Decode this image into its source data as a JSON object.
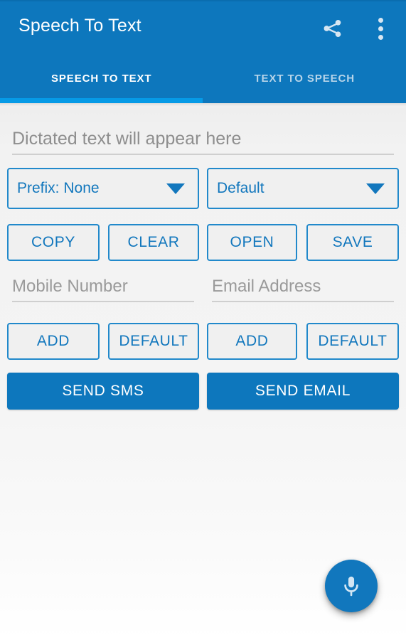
{
  "app": {
    "title": "Speech To Text",
    "accent_color": "#0d77bd",
    "indicator_color": "#069ae6",
    "outline_color": "#2189cb",
    "background_color": "#f4f4f4"
  },
  "appbar": {
    "title": "Speech To Text",
    "share_icon": "share-icon",
    "overflow_icon": "more-vert-icon"
  },
  "tabs": [
    {
      "label": "SPEECH TO TEXT",
      "active": true
    },
    {
      "label": "TEXT TO SPEECH",
      "active": false
    }
  ],
  "main": {
    "dictation": {
      "placeholder": "Dictated text will appear here",
      "value": ""
    },
    "spinners": [
      {
        "label": "Prefix: None",
        "icon": "chevron-down-icon"
      },
      {
        "label": "Default",
        "icon": "chevron-down-icon"
      }
    ],
    "action_buttons": [
      {
        "label": "COPY"
      },
      {
        "label": "CLEAR"
      },
      {
        "label": "OPEN"
      },
      {
        "label": "SAVE"
      }
    ],
    "contact_fields": [
      {
        "placeholder": "Mobile Number",
        "value": ""
      },
      {
        "placeholder": "Email Address",
        "value": ""
      }
    ],
    "contact_buttons": [
      {
        "label": "ADD"
      },
      {
        "label": "DEFAULT"
      },
      {
        "label": "ADD"
      },
      {
        "label": "DEFAULT"
      }
    ],
    "send_buttons": [
      {
        "label": "SEND SMS"
      },
      {
        "label": "SEND EMAIL"
      }
    ]
  },
  "fab": {
    "icon": "microphone-icon",
    "color": "#1177bd"
  }
}
